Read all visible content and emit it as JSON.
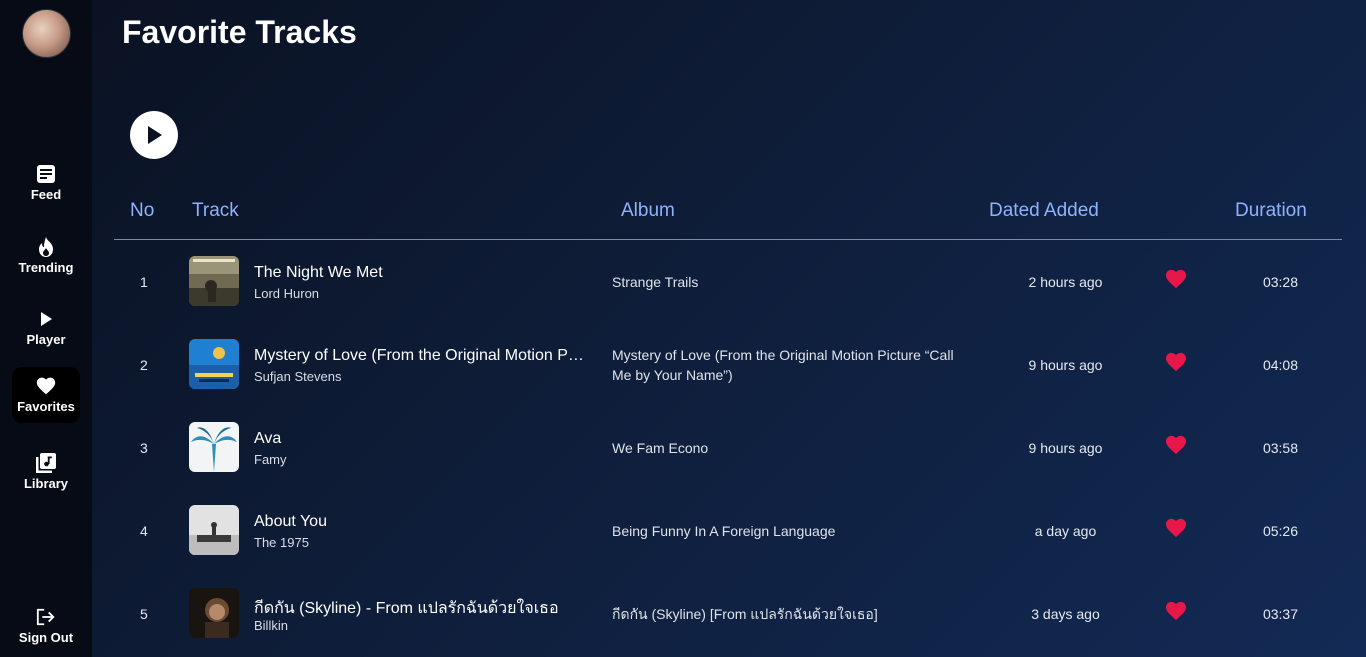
{
  "sidebar": {
    "items": [
      {
        "label": "Feed",
        "icon": "feed-icon"
      },
      {
        "label": "Trending",
        "icon": "flame-icon"
      },
      {
        "label": "Player",
        "icon": "play-icon"
      },
      {
        "label": "Favorites",
        "icon": "heart-icon",
        "active": true
      },
      {
        "label": "Library",
        "icon": "library-icon"
      }
    ],
    "signout": {
      "label": "Sign Out",
      "icon": "sign-out-icon"
    }
  },
  "page": {
    "title": "Favorite Tracks"
  },
  "table": {
    "headers": {
      "no": "No",
      "track": "Track",
      "album": "Album",
      "date": "Dated Added",
      "duration": "Duration"
    },
    "rows": [
      {
        "no": "1",
        "title": "The Night We Met",
        "artist": "Lord Huron",
        "album": "Strange Trails",
        "date": "2 hours ago",
        "duration": "03:28"
      },
      {
        "no": "2",
        "title": "Mystery of Love (From the Original Motion Picture “Call Me by Your Name”)",
        "artist": "Sufjan Stevens",
        "album": "Mystery of Love (From the Original Motion Picture “Call Me by Your Name”)",
        "date": "9 hours ago",
        "duration": "04:08"
      },
      {
        "no": "3",
        "title": "Ava",
        "artist": "Famy",
        "album": "We Fam Econo",
        "date": "9 hours ago",
        "duration": "03:58"
      },
      {
        "no": "4",
        "title": "About You",
        "artist": "The 1975",
        "album": "Being Funny In A Foreign Language",
        "date": "a day ago",
        "duration": "05:26"
      },
      {
        "no": "5",
        "title": "กีดกัน (Skyline) - From แปลรักฉันด้วยใจเธอ",
        "artist": "Billkin",
        "album": "กีดกัน (Skyline) [From แปลรักฉันด้วยใจเธอ]",
        "date": "3 days ago",
        "duration": "03:37"
      }
    ]
  },
  "colors": {
    "accent": "#8fb2ff",
    "heart": "#e8174a",
    "background": "#0f1f3d",
    "sidebar": "#060b16"
  }
}
